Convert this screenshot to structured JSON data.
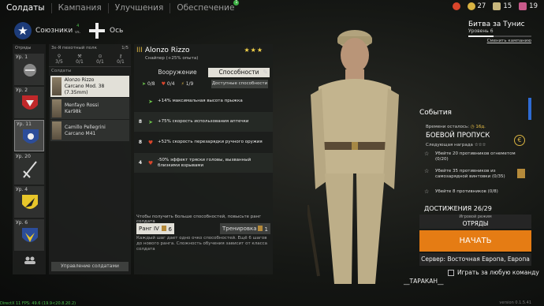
{
  "nav": {
    "tabs": [
      {
        "label": "Солдаты",
        "active": true
      },
      {
        "label": "Кампания",
        "active": false
      },
      {
        "label": "Улучшения",
        "active": false
      },
      {
        "label": "Обеспечение",
        "active": false,
        "badge": "1"
      }
    ]
  },
  "currencies": [
    {
      "icon": "medal-icon",
      "value": "",
      "color": "#d9452b"
    },
    {
      "icon": "gold-icon",
      "value": "27",
      "color": "#d9b342"
    },
    {
      "icon": "ticket-icon",
      "value": "15",
      "color": "#c8b77d"
    },
    {
      "icon": "xp-icon",
      "value": "19",
      "color": "#c85a8a"
    }
  ],
  "factions": {
    "allies": {
      "label": "Союзники",
      "count": "4"
    },
    "vs": "vs.",
    "axis": {
      "label": "Ось"
    }
  },
  "squads": {
    "header": "Отряды",
    "items": [
      {
        "level": "Ур. 1",
        "emblem": "rifle-squad-emblem",
        "selected": false
      },
      {
        "level": "Ур. 2",
        "emblem": "red-shield-emblem",
        "selected": false
      },
      {
        "level": "Ур. 11",
        "emblem": "blue-shield-emblem",
        "selected": true
      },
      {
        "level": "Ур. 20",
        "emblem": "sword-emblem",
        "selected": false
      },
      {
        "level": "Ур. 4",
        "emblem": "lion-emblem",
        "selected": false
      },
      {
        "level": "Ур. 6",
        "emblem": "blue-eagle-emblem",
        "selected": false
      }
    ]
  },
  "soldier_list": {
    "title": "3ε-Я пехотный полк",
    "count": "1/5",
    "stats": [
      {
        "label": "3/5"
      },
      {
        "label": "0/1"
      },
      {
        "label": "0/1"
      },
      {
        "label": "0/1"
      }
    ],
    "label": "Солдаты",
    "soldiers": [
      {
        "name": "Alonzo Rizzo",
        "weapon": "Carcano Mod. 38 (7.35mm)",
        "selected": true
      },
      {
        "name": "Menfayo Rossi",
        "weapon": "Kar98k",
        "selected": false
      },
      {
        "name": "Camillo Pellegrini",
        "weapon": "Carcano M41",
        "selected": false
      }
    ],
    "manage_label": "Управление солдатами"
  },
  "detail": {
    "rank": "III",
    "name": "Alonzo Rizzo",
    "stars": "★★★",
    "subtitle": "Снайпер (+25% опыта)",
    "tabs": [
      "Вооружение",
      "Способности"
    ],
    "ability_points": [
      {
        "icon": "arrow-icon",
        "value": "0/8"
      },
      {
        "icon": "heart-icon",
        "value": "0/4"
      },
      {
        "icon": "bolt-icon",
        "value": "1/9"
      }
    ],
    "available_button": "Доступные способности",
    "abilities": [
      {
        "cost": "",
        "icon": "arrow-icon",
        "text": "+14% максимальная высота прыжка"
      },
      {
        "cost": "8",
        "icon": "arrow-icon",
        "text": "+75% скорость использования аптечки"
      },
      {
        "cost": "8",
        "icon": "heart-icon",
        "text": "+52% скорость перезарядки ручного оружия"
      },
      {
        "cost": "4",
        "icon": "heart-icon",
        "text": "-50% эффект тряски головы, вызванный близкими взрывами"
      }
    ],
    "hint": "Чтобы получить больше способностей, повысьте ранг солдата",
    "rank_button": "Ранг IV",
    "rank_cost": "6",
    "train_button": "Тренировка",
    "train_cost": "1",
    "rank_desc": "Каждый шаг дает одно очко способностей. Ещё 6 шагов до нового ранга. Сложность обучения зависит от класса солдата"
  },
  "battle": {
    "title": "Битва за Тунис",
    "level": "Уровень 6",
    "progress": 0.4,
    "change_link": "Сменить кампанию"
  },
  "events": {
    "title": "События",
    "time_label": "Времени осталось:",
    "time_value": "16д.",
    "battlepass": "БОЕВОЙ ПРОПУСК",
    "next_award": "Следующая награда",
    "next_award_stars": "☆☆☆",
    "tasks": [
      {
        "text": "Убейте 20 противников огнеметом (0/20)"
      },
      {
        "text": "Убейте 35 противников из самозарядной винтовки (0/35)"
      },
      {
        "text": "Убейте 8 противников (0/8)"
      }
    ],
    "achievements": "ДОСТИЖЕНИЯ 26/29"
  },
  "mode": {
    "label": "Игровой режим",
    "value": "ОТРЯДЫ"
  },
  "start_button": "НАЧАТЬ",
  "server": "Сервер: Восточная Европа, Европа",
  "any_team": "Играть за любую команду",
  "username": "__ТАРАКАН__",
  "debug": "DirectX 11 FPS: 49.6 (19.9<20.8.20.2)",
  "version": "version 0.1.5.41"
}
